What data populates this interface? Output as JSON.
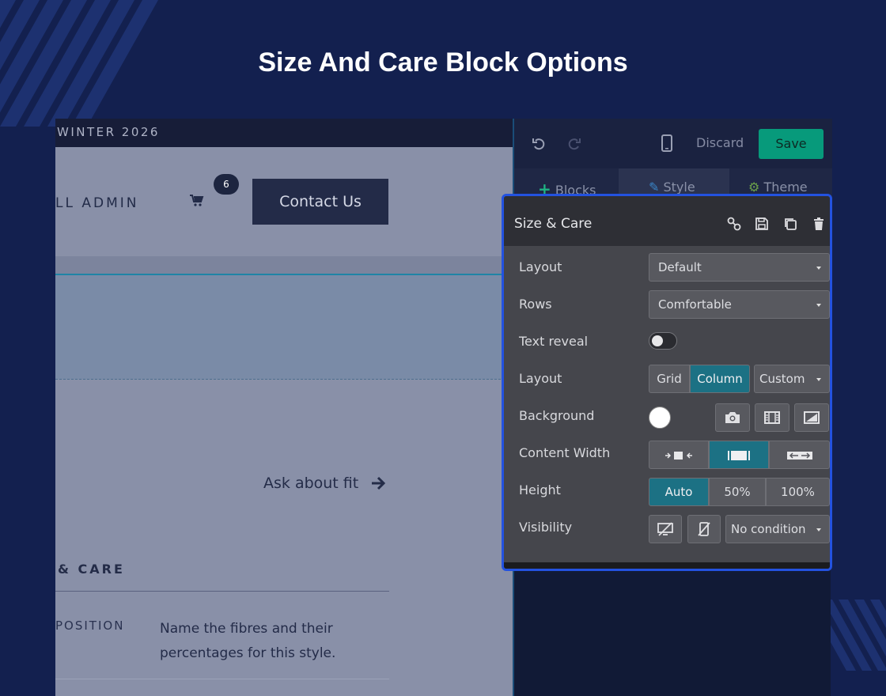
{
  "title": "Size And Care Block Options",
  "site": {
    "announcement": "WINTER 2026",
    "nav_admin": "LL ADMIN",
    "cart_count": "6",
    "contact_label": "Contact Us",
    "ask_link": "Ask about fit",
    "care_heading": "& CARE",
    "composition_label": "POSITION",
    "composition_text": "Name the fibres and their percentages for this style."
  },
  "toolbar": {
    "discard_label": "Discard",
    "save_label": "Save"
  },
  "tabs": [
    {
      "label": "Blocks",
      "icon": "plus-icon"
    },
    {
      "label": "Style",
      "icon": "pencil-icon",
      "active": true
    },
    {
      "label": "Theme",
      "icon": "gear-icon"
    }
  ],
  "panel": {
    "title": "Size & Care",
    "header_icons": [
      "link-icon",
      "save-icon",
      "duplicate-icon",
      "trash-icon"
    ],
    "rows": {
      "layout_select": {
        "label": "Layout",
        "value": "Default"
      },
      "rows_select": {
        "label": "Rows",
        "value": "Comfortable"
      },
      "text_reveal": {
        "label": "Text reveal",
        "enabled": false
      },
      "layout_mode": {
        "label": "Layout",
        "options": [
          "Grid",
          "Column"
        ],
        "selected": "Column",
        "custom": "Custom"
      },
      "background": {
        "label": "Background",
        "color": "#ffffff",
        "icons": [
          "camera-icon",
          "film-icon",
          "gradient-icon"
        ]
      },
      "content_width": {
        "label": "Content Width",
        "options": [
          "narrow-width-icon",
          "medium-width-icon",
          "full-width-icon"
        ],
        "selected": "medium-width-icon"
      },
      "height": {
        "label": "Height",
        "options": [
          "Auto",
          "50%",
          "100%"
        ],
        "selected": "Auto"
      },
      "visibility": {
        "label": "Visibility",
        "icons": [
          "hide-desktop-icon",
          "hide-mobile-icon"
        ],
        "condition": "No condition"
      }
    }
  },
  "colors": {
    "background": "#13204f",
    "accent": "#079a7b",
    "panel_border": "#2352e0",
    "active_segment": "#1c7184"
  }
}
